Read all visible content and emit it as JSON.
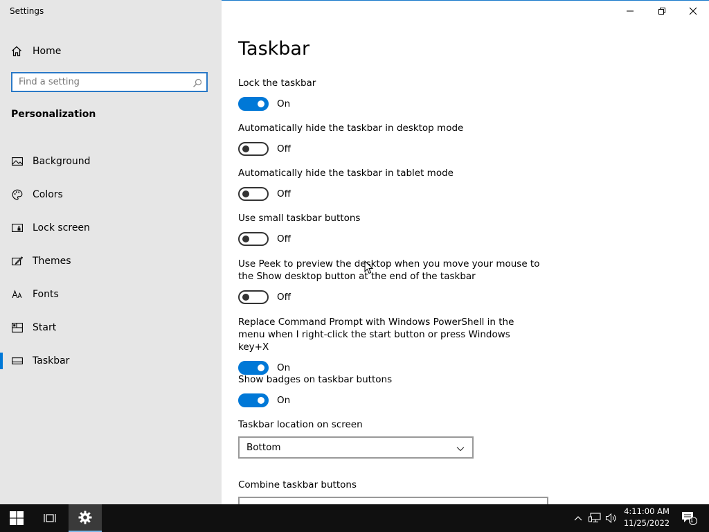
{
  "window": {
    "title": "Settings",
    "controls": {
      "minimize": "minimize",
      "restore": "restore",
      "close": "close"
    }
  },
  "sidebar": {
    "home_label": "Home",
    "search_placeholder": "Find a setting",
    "section_title": "Personalization",
    "items": [
      {
        "label": "Background",
        "icon": "picture-icon",
        "selected": false
      },
      {
        "label": "Colors",
        "icon": "palette-icon",
        "selected": false
      },
      {
        "label": "Lock screen",
        "icon": "lock-screen-icon",
        "selected": false
      },
      {
        "label": "Themes",
        "icon": "themes-icon",
        "selected": false
      },
      {
        "label": "Fonts",
        "icon": "fonts-icon",
        "selected": false
      },
      {
        "label": "Start",
        "icon": "start-icon",
        "selected": false
      },
      {
        "label": "Taskbar",
        "icon": "taskbar-icon",
        "selected": true
      }
    ]
  },
  "main": {
    "title": "Taskbar",
    "settings": [
      {
        "label": "Lock the taskbar",
        "state": "On"
      },
      {
        "label": "Automatically hide the taskbar in desktop mode",
        "state": "Off"
      },
      {
        "label": "Automatically hide the taskbar in tablet mode",
        "state": "Off"
      },
      {
        "label": "Use small taskbar buttons",
        "state": "Off"
      },
      {
        "label": "Use Peek to preview the desktop when you move your mouse to the Show desktop button at the end of the taskbar",
        "state": "Off"
      },
      {
        "label": "Replace Command Prompt with Windows PowerShell in the menu when I right-click the start button or press Windows key+X",
        "state": "On"
      },
      {
        "label": "Show badges on taskbar buttons",
        "state": "On"
      }
    ],
    "location_label": "Taskbar location on screen",
    "location_value": "Bottom",
    "combine_label": "Combine taskbar buttons"
  },
  "taskbar": {
    "time": "4:11:00 AM",
    "date": "11/25/2022",
    "notification_count": "1"
  },
  "colors": {
    "accent": "#0078d7",
    "sidebar_bg": "#e6e6e6",
    "taskbar_bg": "#101010"
  }
}
